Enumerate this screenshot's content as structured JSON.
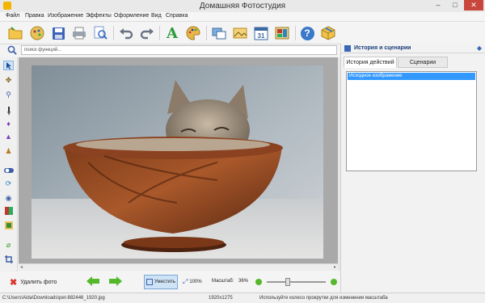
{
  "window": {
    "title": "Домашняя Фотостудия",
    "controls": {
      "minimize": "–",
      "maximize": "□",
      "close": "✕"
    }
  },
  "menu": [
    "Файл",
    "Правка",
    "Изображение",
    "Эффекты",
    "Оформление",
    "Вид",
    "Справка"
  ],
  "toolbar": {
    "icons": [
      "open-folder-icon",
      "gallery-icon",
      "save-icon",
      "print-icon",
      "zoom-page-icon",
      "undo-icon",
      "redo-icon",
      "text-icon",
      "palette-icon",
      "frames-icon",
      "postcard-icon",
      "calendar-icon",
      "collage-icon",
      "help-icon",
      "package-icon"
    ],
    "text_glyph": "A",
    "help_glyph": "?"
  },
  "search": {
    "placeholder": "поиск функций..."
  },
  "right_panel": {
    "title": "История и сценарии",
    "tabs": [
      "История действий",
      "Сценарии"
    ],
    "active_tab": 0,
    "history": [
      "Исходное изображение"
    ]
  },
  "bottom": {
    "delete_label": "Удалить фото",
    "fit_label": "Уместить",
    "zoom100_label": "100%",
    "scale_label": "Масштаб:",
    "scale_value": "36%",
    "zoom_level": 0.36
  },
  "status": {
    "path": "C:\\Users\\Aida\\Downloads\\pet-882446_1920.jpg",
    "dimensions": "1920x1275",
    "hint": "Используйте колесо прокрутки для изменения масштаба"
  },
  "colors": {
    "accent": "#3399ff",
    "panel_title": "#1b3f7c",
    "arrows": "#55b82c",
    "delete": "#d9342b"
  }
}
